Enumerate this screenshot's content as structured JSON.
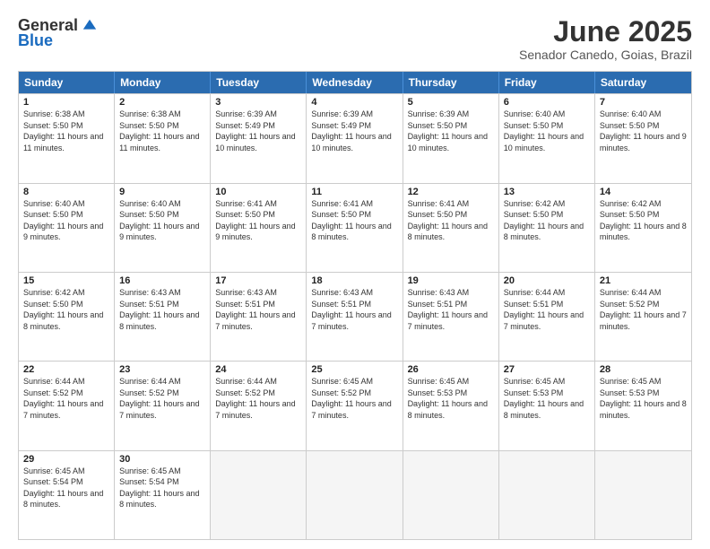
{
  "logo": {
    "general": "General",
    "blue": "Blue"
  },
  "title": "June 2025",
  "subtitle": "Senador Canedo, Goias, Brazil",
  "days": [
    "Sunday",
    "Monday",
    "Tuesday",
    "Wednesday",
    "Thursday",
    "Friday",
    "Saturday"
  ],
  "weeks": [
    [
      {
        "day": "1",
        "info": "Sunrise: 6:38 AM\nSunset: 5:50 PM\nDaylight: 11 hours and 11 minutes."
      },
      {
        "day": "2",
        "info": "Sunrise: 6:38 AM\nSunset: 5:50 PM\nDaylight: 11 hours and 11 minutes."
      },
      {
        "day": "3",
        "info": "Sunrise: 6:39 AM\nSunset: 5:49 PM\nDaylight: 11 hours and 10 minutes."
      },
      {
        "day": "4",
        "info": "Sunrise: 6:39 AM\nSunset: 5:49 PM\nDaylight: 11 hours and 10 minutes."
      },
      {
        "day": "5",
        "info": "Sunrise: 6:39 AM\nSunset: 5:50 PM\nDaylight: 11 hours and 10 minutes."
      },
      {
        "day": "6",
        "info": "Sunrise: 6:40 AM\nSunset: 5:50 PM\nDaylight: 11 hours and 10 minutes."
      },
      {
        "day": "7",
        "info": "Sunrise: 6:40 AM\nSunset: 5:50 PM\nDaylight: 11 hours and 9 minutes."
      }
    ],
    [
      {
        "day": "8",
        "info": "Sunrise: 6:40 AM\nSunset: 5:50 PM\nDaylight: 11 hours and 9 minutes."
      },
      {
        "day": "9",
        "info": "Sunrise: 6:40 AM\nSunset: 5:50 PM\nDaylight: 11 hours and 9 minutes."
      },
      {
        "day": "10",
        "info": "Sunrise: 6:41 AM\nSunset: 5:50 PM\nDaylight: 11 hours and 9 minutes."
      },
      {
        "day": "11",
        "info": "Sunrise: 6:41 AM\nSunset: 5:50 PM\nDaylight: 11 hours and 8 minutes."
      },
      {
        "day": "12",
        "info": "Sunrise: 6:41 AM\nSunset: 5:50 PM\nDaylight: 11 hours and 8 minutes."
      },
      {
        "day": "13",
        "info": "Sunrise: 6:42 AM\nSunset: 5:50 PM\nDaylight: 11 hours and 8 minutes."
      },
      {
        "day": "14",
        "info": "Sunrise: 6:42 AM\nSunset: 5:50 PM\nDaylight: 11 hours and 8 minutes."
      }
    ],
    [
      {
        "day": "15",
        "info": "Sunrise: 6:42 AM\nSunset: 5:50 PM\nDaylight: 11 hours and 8 minutes."
      },
      {
        "day": "16",
        "info": "Sunrise: 6:43 AM\nSunset: 5:51 PM\nDaylight: 11 hours and 8 minutes."
      },
      {
        "day": "17",
        "info": "Sunrise: 6:43 AM\nSunset: 5:51 PM\nDaylight: 11 hours and 7 minutes."
      },
      {
        "day": "18",
        "info": "Sunrise: 6:43 AM\nSunset: 5:51 PM\nDaylight: 11 hours and 7 minutes."
      },
      {
        "day": "19",
        "info": "Sunrise: 6:43 AM\nSunset: 5:51 PM\nDaylight: 11 hours and 7 minutes."
      },
      {
        "day": "20",
        "info": "Sunrise: 6:44 AM\nSunset: 5:51 PM\nDaylight: 11 hours and 7 minutes."
      },
      {
        "day": "21",
        "info": "Sunrise: 6:44 AM\nSunset: 5:52 PM\nDaylight: 11 hours and 7 minutes."
      }
    ],
    [
      {
        "day": "22",
        "info": "Sunrise: 6:44 AM\nSunset: 5:52 PM\nDaylight: 11 hours and 7 minutes."
      },
      {
        "day": "23",
        "info": "Sunrise: 6:44 AM\nSunset: 5:52 PM\nDaylight: 11 hours and 7 minutes."
      },
      {
        "day": "24",
        "info": "Sunrise: 6:44 AM\nSunset: 5:52 PM\nDaylight: 11 hours and 7 minutes."
      },
      {
        "day": "25",
        "info": "Sunrise: 6:45 AM\nSunset: 5:52 PM\nDaylight: 11 hours and 7 minutes."
      },
      {
        "day": "26",
        "info": "Sunrise: 6:45 AM\nSunset: 5:53 PM\nDaylight: 11 hours and 8 minutes."
      },
      {
        "day": "27",
        "info": "Sunrise: 6:45 AM\nSunset: 5:53 PM\nDaylight: 11 hours and 8 minutes."
      },
      {
        "day": "28",
        "info": "Sunrise: 6:45 AM\nSunset: 5:53 PM\nDaylight: 11 hours and 8 minutes."
      }
    ],
    [
      {
        "day": "29",
        "info": "Sunrise: 6:45 AM\nSunset: 5:54 PM\nDaylight: 11 hours and 8 minutes."
      },
      {
        "day": "30",
        "info": "Sunrise: 6:45 AM\nSunset: 5:54 PM\nDaylight: 11 hours and 8 minutes."
      },
      {
        "day": "",
        "info": ""
      },
      {
        "day": "",
        "info": ""
      },
      {
        "day": "",
        "info": ""
      },
      {
        "day": "",
        "info": ""
      },
      {
        "day": "",
        "info": ""
      }
    ]
  ]
}
